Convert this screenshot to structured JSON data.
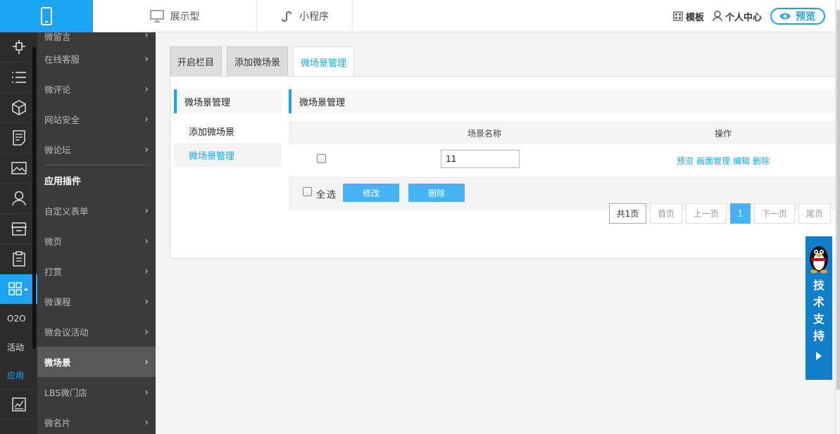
{
  "topbar": {
    "tabs": [
      {
        "label": "展示型",
        "icon": "monitor-icon"
      },
      {
        "label": "小程序",
        "icon": "miniprogram-icon"
      }
    ],
    "template_label": "模板",
    "user_center_label": "个人中心",
    "preview_label": "预览"
  },
  "rail": {
    "text_items": [
      "O2O",
      "活动",
      "应用"
    ]
  },
  "submenu": {
    "items_top": [
      "微留言",
      "在线客服",
      "微评论",
      "网站安全",
      "微论坛"
    ],
    "section_title": "应用插件",
    "items_bottom": [
      "自定义表单",
      "微页",
      "打赏",
      "微课程",
      "微会议活动",
      "微场景",
      "LBS微门店",
      "微名片"
    ],
    "active_item": "微场景"
  },
  "tabs": [
    "开启栏目",
    "添加微场景",
    "微场景管理"
  ],
  "leftnav": {
    "header": "微场景管理",
    "items": [
      "添加微场景",
      "微场景管理"
    ]
  },
  "content": {
    "header": "微场景管理",
    "columns": [
      "场景名称",
      "操作"
    ],
    "rows": [
      {
        "name": "11",
        "ops": [
          "预览",
          "画面管理",
          "编辑",
          "删除"
        ]
      }
    ],
    "select_all": "全选",
    "modify_button": "修改",
    "delete_button": "删除"
  },
  "pager": {
    "total": "共1页",
    "first": "首页",
    "prev": "上一页",
    "current": "1",
    "next": "下一页",
    "last": "尾页"
  },
  "support": {
    "label": "技术支持"
  },
  "colors": {
    "accent": "#1aa4f2",
    "button": "#46b4f4",
    "support": "#0f7fc9"
  }
}
